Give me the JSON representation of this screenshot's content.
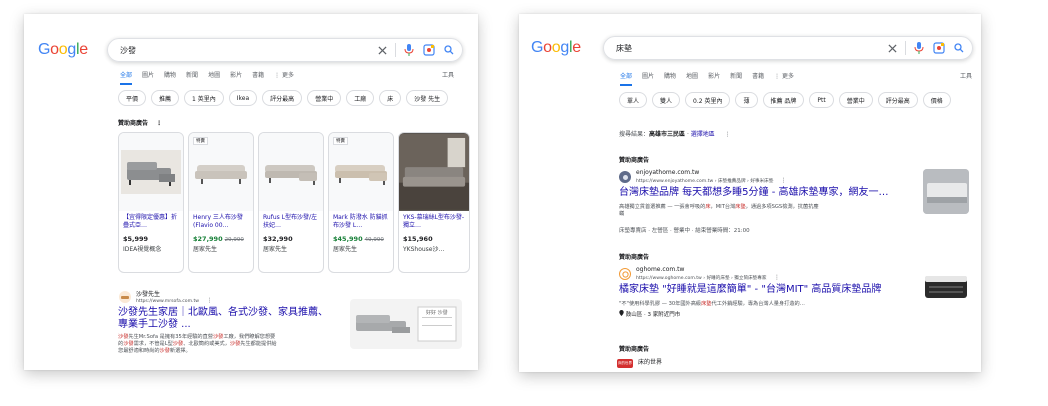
{
  "left": {
    "query": "沙發",
    "tabs": [
      "全部",
      "圖片",
      "購物",
      "新聞",
      "地圖",
      "影片",
      "書籍",
      "⋮ 更多"
    ],
    "tools": "工具",
    "chips": [
      "平價",
      "推薦",
      "1 英里內",
      "Ikea",
      "評分最高",
      "營業中",
      "工廠",
      "床",
      "沙發 先生"
    ],
    "sponsor_label": "贊助商廣告",
    "more_glyph": "⋮",
    "products": [
      {
        "badge": "",
        "name": "【宜得限定優惠】折疊式亞…",
        "price": "$5,999",
        "old": "",
        "store": "IDEA視覺概念",
        "green": false
      },
      {
        "badge": "特賣",
        "name": "Henry 三人布沙發 (Flavio 00…",
        "price": "$27,990",
        "old": "29,990",
        "store": "居家先生",
        "green": true
      },
      {
        "badge": "",
        "name": "Rufus L型布沙發/左扶妃…",
        "price": "$32,990",
        "old": "",
        "store": "居家先生",
        "green": false
      },
      {
        "badge": "特賣",
        "name": "Mark 防潑水 防貓抓布沙發 L…",
        "price": "$45,990",
        "old": "49,990",
        "store": "居家先生",
        "green": true
      },
      {
        "badge": "",
        "name": "YKS-慕瑞絲L型布沙發-獨立…",
        "price": "$15,960",
        "old": "",
        "store": "YKShouse沙…",
        "green": false
      }
    ],
    "ad": {
      "site": "沙發先生",
      "url": "https://www.mrsofa.com.tw",
      "title_1": "沙發先生家居｜北歐風、各式沙發、家具推薦、",
      "title_2": "專業手工沙發 ...",
      "d1a": "沙發",
      "d1b": "先生Mr.Sofa 是擁有35年經驗的直營",
      "d1c": "沙發",
      "d1d": "工廠，我們瞭解您想要",
      "d2a": "的",
      "d2b": "沙發",
      "d2c": "需求，不管是L型",
      "d2d": "沙發",
      "d2e": "、北歐簡約或美式，",
      "d2f": "沙發",
      "d2g": "先生都能提供給",
      "d3a": "您最舒適和時尚的",
      "d3b": "沙發",
      "d3c": "新選擇。",
      "thumb_text": "好好 沙發"
    }
  },
  "right": {
    "query": "床墊",
    "tabs": [
      "全部",
      "圖片",
      "購物",
      "地圖",
      "影片",
      "新聞",
      "書籍",
      "⋮ 更多"
    ],
    "tools": "工具",
    "chips": [
      "單人",
      "雙人",
      "0.2 英里內",
      "薄",
      "推薦 品牌",
      "Ptt",
      "營業中",
      "評分最高",
      "價格"
    ],
    "loc_prefix": "搜尋結果：",
    "loc_place": "高雄市三民區",
    "loc_dot": " · ",
    "loc_link": "選擇地區",
    "more_glyph": "⋮",
    "ads": [
      {
        "label": "贊助商廣告",
        "site": "enjoyathome.com.tw",
        "url": "https://www.enjoyathome.com.tw › 床墊推薦品牌 › 好事米床墊",
        "title": "台灣床墊品牌 每天都想多睡5分鐘 - 高雄床墊專家，網友一…",
        "d1a": "高雄獨立貨首選推薦 — 一張會呼吸的",
        "d1b": "床",
        "d1c": "，MIT台灣",
        "d1d": "床墊",
        "d1e": "，通過多項SGS檢測，抗菌抗塵",
        "d2": "蟎",
        "meta": "床墊專賣店 · 左營區 · 營業中 · 結束營業時間：21:00"
      },
      {
        "label": "贊助商廣告",
        "site": "oghome.com.tw",
        "url": "https://www.oghome.com.tw › 好睡的床墊 › 獨立筒床墊專家",
        "title": "橘家床墊 \"好睡就是這麼簡單\" - \"台灣MIT\" 高品質床墊品牌",
        "d1a": "\"不\"使用科學乳膠 — 30年國外高級",
        "d1b": "床墊",
        "d1c": "代工外銷經驗，專為台灣人量身打造的…",
        "meta": "鼓山區 · 3 家附近門市"
      },
      {
        "label": "贊助商廣告",
        "site": "床的世界",
        "logo_text": "床的世界"
      }
    ]
  }
}
